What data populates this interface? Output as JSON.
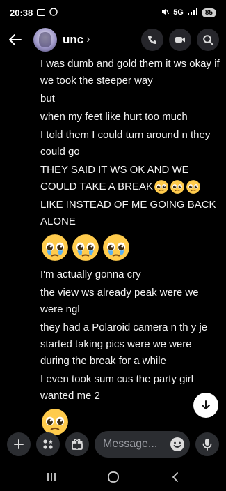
{
  "status_bar": {
    "time": "20:38",
    "network": "5G",
    "battery": "85"
  },
  "header": {
    "title": "unc",
    "chevron": "›"
  },
  "messages": [
    {
      "text": "I was dumb and gold them it ws okay if we took the steeper way"
    },
    {
      "text": "but"
    },
    {
      "text": "when my feet like hurt too much"
    },
    {
      "text": "I told them I could turn around n they could go"
    },
    {
      "text": "THEY SAID IT WS OK AND WE COULD TAKE A BREAK",
      "emojis": [
        "pleading-face-emoji",
        "pleading-face-emoji",
        "pleading-face-emoji"
      ]
    },
    {
      "text": "LIKE INSTEAD OF ME GOING BACK ALONE"
    },
    {
      "jumbo_emojis": [
        "pleading-face-tears-emoji",
        "pleading-face-tears-emoji",
        "pleading-face-tears-emoji"
      ]
    },
    {
      "text": "I'm actually gonna cry"
    },
    {
      "text": "the view ws already peak were we were ngl"
    },
    {
      "text": "they had a Polaroid camera n th y je started taking pics were we were during the break for a while"
    },
    {
      "text": "I even took sum cus the party girl wanted me 2"
    },
    {
      "jumbo_emojis": [
        "pleading-face-emoji"
      ]
    }
  ],
  "composer": {
    "placeholder": "Message..."
  },
  "icons": {
    "back": "arrow-left-icon",
    "call": "phone-icon",
    "video": "video-icon",
    "search": "search-icon",
    "plus": "plus-icon",
    "apps": "apps-icon",
    "gift": "gift-icon",
    "emoji": "emoji-icon",
    "mic": "mic-icon",
    "jump": "arrow-down-icon"
  },
  "colors": {
    "background": "#000000",
    "surface": "#2b2d31",
    "text": "#f2f2f2",
    "muted": "#9a9ca3"
  }
}
